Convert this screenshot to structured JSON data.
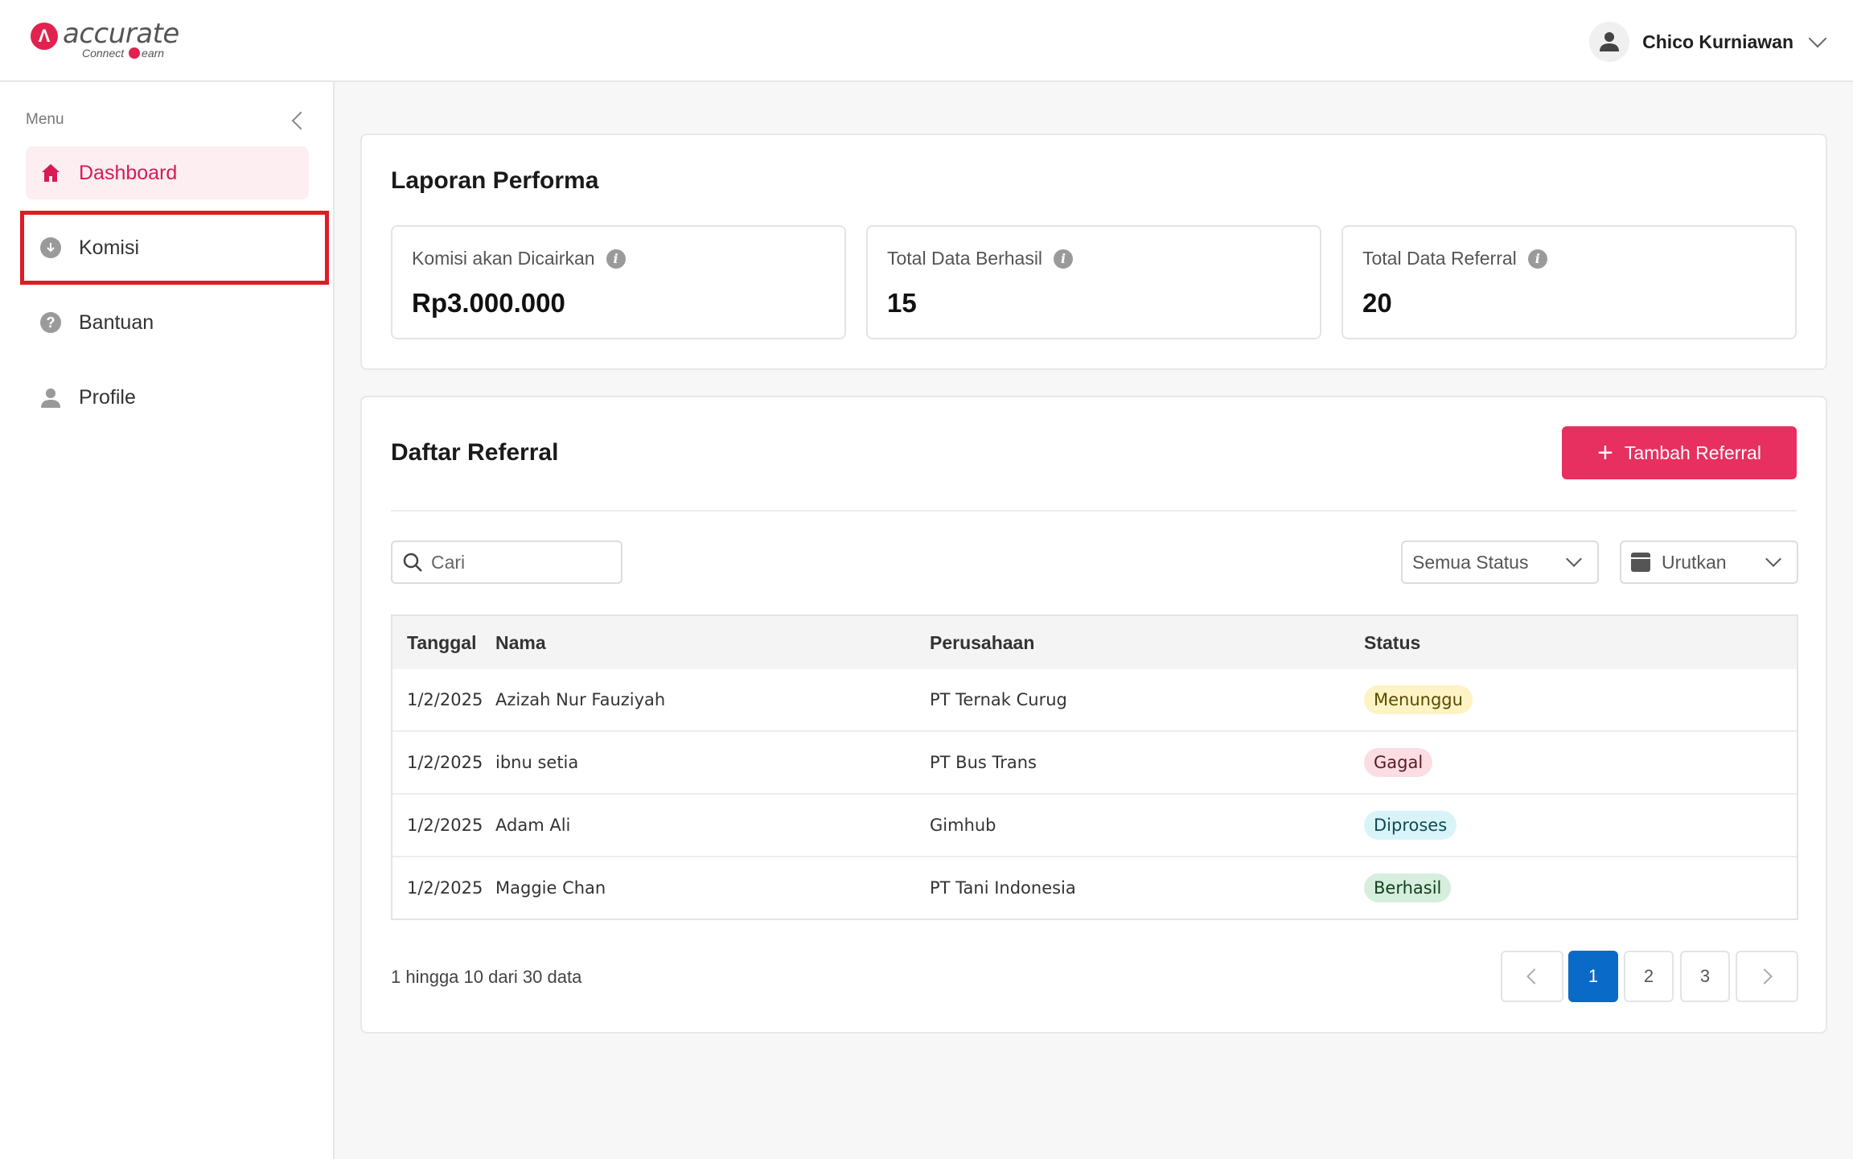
{
  "brand": {
    "name": "accurate",
    "sub_left": "Connect",
    "sub_right": "earn",
    "color": "#e2224e"
  },
  "header": {
    "user_name": "Chico Kurniawan"
  },
  "sidebar": {
    "menu_label": "Menu",
    "items": [
      {
        "label": "Dashboard",
        "icon": "home-icon",
        "active": true
      },
      {
        "label": "Komisi",
        "icon": "download-circle-icon",
        "active": false
      },
      {
        "label": "Bantuan",
        "icon": "question-circle-icon",
        "active": false
      },
      {
        "label": "Profile",
        "icon": "user-icon",
        "active": false
      }
    ]
  },
  "performance": {
    "title": "Laporan Performa",
    "stats": [
      {
        "label": "Komisi akan Dicairkan",
        "value": "Rp3.000.000"
      },
      {
        "label": "Total Data Berhasil",
        "value": "15"
      },
      {
        "label": "Total Data Referral",
        "value": "20"
      }
    ]
  },
  "referral": {
    "title": "Daftar Referral",
    "add_button": "Tambah Referral",
    "search_placeholder": "Cari",
    "status_filter": "Semua Status",
    "sort_label": "Urutkan",
    "columns": [
      "Tanggal",
      "Nama",
      "Perusahaan",
      "Status"
    ],
    "rows": [
      {
        "date": "1/2/2025",
        "name": "Azizah Nur Fauziyah",
        "company": "PT Ternak Curug",
        "status": "Menunggu",
        "status_bg": "#fdf3c4",
        "status_fg": "#5a4a00"
      },
      {
        "date": "1/2/2025",
        "name": "ibnu setia",
        "company": "PT Bus Trans",
        "status": "Gagal",
        "status_bg": "#fbdde2",
        "status_fg": "#5a1a22"
      },
      {
        "date": "1/2/2025",
        "name": "Adam Ali",
        "company": "Gimhub",
        "status": "Diproses",
        "status_bg": "#d8f4f8",
        "status_fg": "#0f4a55"
      },
      {
        "date": "1/2/2025",
        "name": "Maggie Chan",
        "company": "PT Tani Indonesia",
        "status": "Berhasil",
        "status_bg": "#d6eedd",
        "status_fg": "#13401f"
      }
    ],
    "pagination": {
      "summary": "1 hingga 10 dari 30 data",
      "pages": [
        "1",
        "2",
        "3"
      ],
      "current": "1"
    }
  }
}
